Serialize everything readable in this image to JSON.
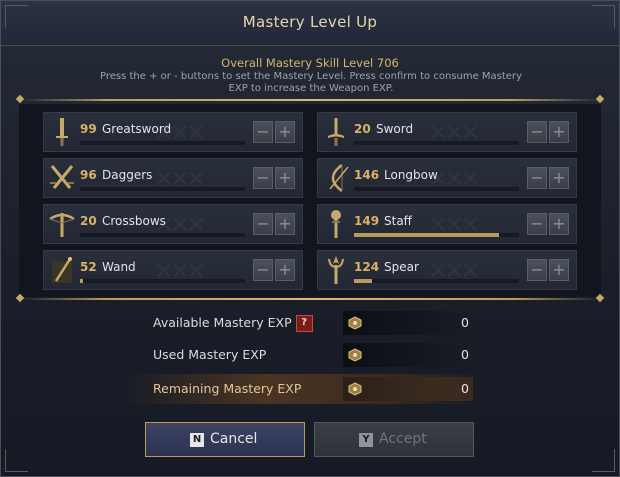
{
  "dialog": {
    "title": "Mastery Level Up",
    "subtitle": "Overall Mastery Skill Level 706",
    "description": "Press the + or - buttons to set the Mastery Level. Press confirm to consume Mastery EXP to increase the Weapon EXP."
  },
  "weapons": [
    {
      "name": "Greatsword",
      "level": "99",
      "progress": 0.0,
      "icon": "greatsword-icon"
    },
    {
      "name": "Sword",
      "level": "20",
      "progress": 0.0,
      "icon": "sword-icon"
    },
    {
      "name": "Daggers",
      "level": "96",
      "progress": 0.0,
      "icon": "daggers-icon"
    },
    {
      "name": "Longbow",
      "level": "146",
      "progress": 0.0,
      "icon": "longbow-icon"
    },
    {
      "name": "Crossbows",
      "level": "20",
      "progress": 0.0,
      "icon": "crossbows-icon"
    },
    {
      "name": "Staff",
      "level": "149",
      "progress": 0.88,
      "icon": "staff-icon"
    },
    {
      "name": "Wand",
      "level": "52",
      "progress": 0.02,
      "icon": "wand-icon"
    },
    {
      "name": "Spear",
      "level": "124",
      "progress": 0.11,
      "icon": "spear-icon"
    }
  ],
  "buttons": {
    "minus": "−",
    "plus": "+"
  },
  "exp": {
    "available_label": "Available Mastery EXP",
    "available_value": "0",
    "help": "?",
    "used_label": "Used Mastery EXP",
    "used_value": "0",
    "remaining_label": "Remaining Mastery EXP",
    "remaining_value": "0",
    "currency_icon": "mastery-exp-icon"
  },
  "actions": {
    "cancel_key": "N",
    "cancel_label": "Cancel",
    "accept_key": "Y",
    "accept_label": "Accept"
  },
  "colors": {
    "accent": "#d8b26a",
    "progress": "#b89b5d",
    "help": "#7a1c1a"
  }
}
